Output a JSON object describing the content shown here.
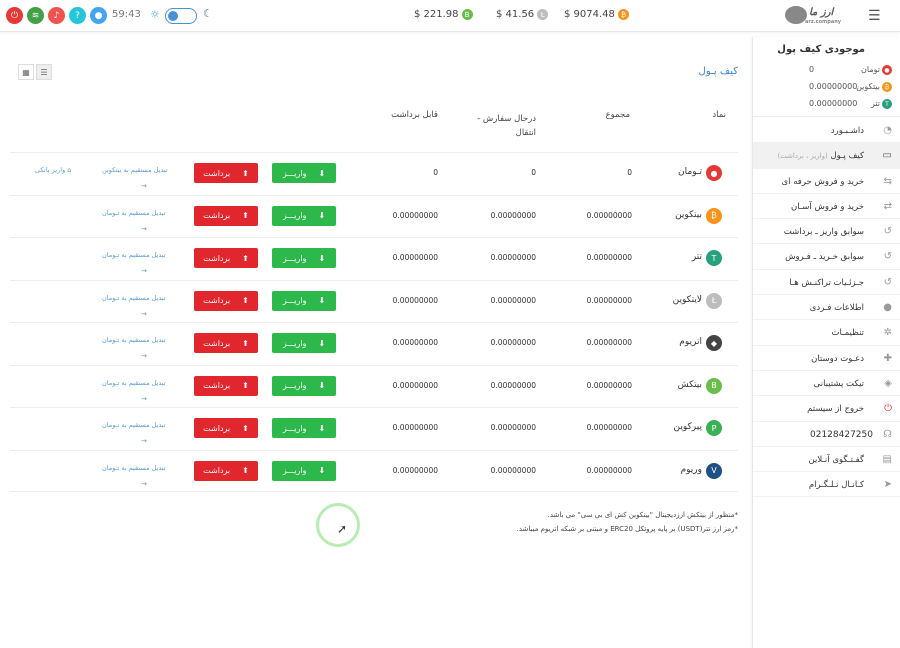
{
  "topbar": {
    "icons": [
      {
        "name": "power-icon",
        "glyph": "⏻",
        "color": "#e53935"
      },
      {
        "name": "wifi-icon",
        "glyph": "≋",
        "color": "#43a047"
      },
      {
        "name": "bell-icon",
        "glyph": "♪",
        "color": "#ef5350"
      },
      {
        "name": "help-icon",
        "glyph": "?",
        "color": "#26c6da"
      },
      {
        "name": "user-icon",
        "glyph": "●",
        "color": "#42a5f5"
      }
    ],
    "clock": "59:43",
    "prices": [
      {
        "value": "$ 221.98",
        "coin_color": "#6abf4b",
        "coin_glyph": "B"
      },
      {
        "value": "$ 41.56",
        "coin_color": "#bdbdbd",
        "coin_glyph": "Ł"
      },
      {
        "value": "$ 9074.48",
        "coin_color": "#f7931a",
        "coin_glyph": "₿"
      }
    ],
    "logo_text": "ارز ما",
    "logo_sub": "arz.company"
  },
  "sidebar": {
    "title": "موجودی کیف پول",
    "balances": [
      {
        "name": "تومان",
        "value": "0",
        "color": "#e53935",
        "glyph": "●"
      },
      {
        "name": "بیتکوین",
        "value": "0.00000000",
        "color": "#f7931a",
        "glyph": "₿"
      },
      {
        "name": "تتر",
        "value": "0.00000000",
        "color": "#26a17b",
        "glyph": "T"
      }
    ],
    "nav": [
      {
        "label": "داشـبـورد",
        "icon": "◔",
        "name": "dashboard"
      },
      {
        "label": "کیف پـول",
        "sub": "(واریز ، برداشت)",
        "icon": "▭",
        "name": "wallet",
        "active": true
      },
      {
        "label": "خرید و فروش حرفه ای",
        "icon": "⇆",
        "name": "pro-trade"
      },
      {
        "label": "خرید و فروش آسـان",
        "icon": "⇄",
        "name": "easy-trade"
      },
      {
        "label": "سوابق واریز ـ برداشت",
        "icon": "↺",
        "name": "deposit-history"
      },
      {
        "label": "سوابق خـرید ـ فـروش",
        "icon": "↺",
        "name": "trade-history"
      },
      {
        "label": "جـزئـیات تراکنـش هـا",
        "icon": "↺",
        "name": "transactions"
      },
      {
        "label": "اطلاعات فـردی",
        "icon": "●",
        "name": "profile"
      },
      {
        "label": "تنظیمـات",
        "icon": "✲",
        "name": "settings"
      },
      {
        "label": "دعـوت دوستان",
        "icon": "✚",
        "name": "invite"
      },
      {
        "label": "تیکت پشتیبانی",
        "icon": "◈",
        "name": "ticket"
      },
      {
        "label": "خروج از سیستم",
        "icon": "⏻",
        "name": "logout"
      },
      {
        "label": "02128427250",
        "icon": "☊",
        "name": "phone"
      },
      {
        "label": "گفـتـگوی آنـلاین",
        "icon": "▤",
        "name": "chat"
      },
      {
        "label": "کـانـال تـلـگـرام",
        "icon": "➤",
        "name": "telegram"
      }
    ]
  },
  "main": {
    "title": "کیف پـول",
    "headers": {
      "symbol": "نماد",
      "total": "مجموع",
      "in_order": "درحال سفارش - انتقال",
      "withdrawable": "قابل برداشت"
    },
    "deposit_label": "واریـــز",
    "withdraw_label": "برداشت",
    "convert_toman": "تبدیل مستقیم به تـومان",
    "convert_btc": "تبدیل مستقیم به بیتکوین",
    "bank_return": "واریز بانکی",
    "arrow": "→",
    "rows": [
      {
        "name": "تـومان",
        "total": "0",
        "in_order": "0",
        "withdrawable": "0",
        "color": "#e53935",
        "glyph": "●"
      },
      {
        "name": "بیتکوین",
        "total": "0.00000000",
        "in_order": "0.00000000",
        "withdrawable": "0.00000000",
        "color": "#f7931a",
        "glyph": "₿"
      },
      {
        "name": "تتر",
        "total": "0.00000000",
        "in_order": "0.00000000",
        "withdrawable": "0.00000000",
        "color": "#26a17b",
        "glyph": "T"
      },
      {
        "name": "لایتکوین",
        "total": "0.00000000",
        "in_order": "0.00000000",
        "withdrawable": "0.00000000",
        "color": "#bdbdbd",
        "glyph": "Ł"
      },
      {
        "name": "اتریوم",
        "total": "0.00000000",
        "in_order": "0.00000000",
        "withdrawable": "0.00000000",
        "color": "#444444",
        "glyph": "◆"
      },
      {
        "name": "بیتکش",
        "total": "0.00000000",
        "in_order": "0.00000000",
        "withdrawable": "0.00000000",
        "color": "#6abf4b",
        "glyph": "B"
      },
      {
        "name": "پیرکوین",
        "total": "0.00000000",
        "in_order": "0.00000000",
        "withdrawable": "0.00000000",
        "color": "#3cb054",
        "glyph": "P"
      },
      {
        "name": "وریوم",
        "total": "0.00000000",
        "in_order": "0.00000000",
        "withdrawable": "0.00000000",
        "color": "#1e4f86",
        "glyph": "V"
      }
    ],
    "notes": [
      "*منظور از بیتکش ارزدیجیتال \"بیتکوین کش ای بی سی\" می باشد.",
      "*رمز ارز تتر(USDT) بر پایه پروتکل ERC20 و مبتنی بر شبکه اتریوم میباشد."
    ]
  }
}
